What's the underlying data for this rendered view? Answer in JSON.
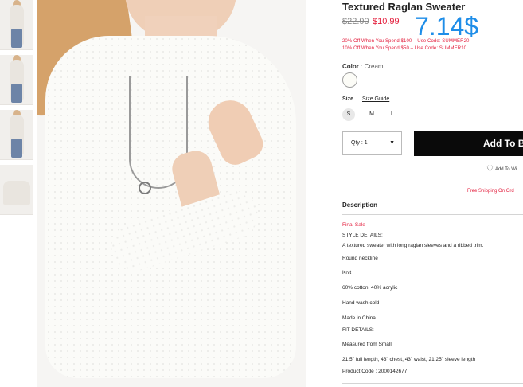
{
  "product": {
    "title": "Textured Raglan Sweater",
    "old_price": "$22.90",
    "new_price": "$10.99",
    "overlay_price": "7.14$",
    "promos": [
      "20% Off When You Spend $100 – Use Code: SUMMER20",
      "10% Off When You Spend $50 – Use Code: SUMMER10"
    ]
  },
  "options": {
    "color_label": "Color",
    "color_value": ": Cream",
    "size_label": "Size",
    "size_guide": "Size Guide",
    "sizes": [
      "S",
      "M",
      "L"
    ],
    "qty_text": "Qty : 1",
    "qty_caret": "▼",
    "add_to_bag": "Add To B",
    "wishlist": "Add To Wi",
    "free_shipping": "Free Shipping On Ord"
  },
  "description": {
    "heading": "Description",
    "lines": [
      "Final Sale",
      "STYLE DETAILS:",
      "A textured sweater with long raglan sleeves and a ribbed trim.",
      "Round neckline",
      "Knit",
      "60% cotton, 40% acrylic",
      "Hand wash cold",
      "Made in China",
      "FIT DETAILS:",
      "Measured from Small",
      "21.5\" full length, 43\" chest, 43\" waist, 21.25\" sleeve length",
      "Product Code : 2000142677"
    ]
  },
  "colors": {
    "sale_red": "#e31b3a",
    "overlay_blue": "#1e8de8",
    "button_black": "#0a0a0a"
  }
}
